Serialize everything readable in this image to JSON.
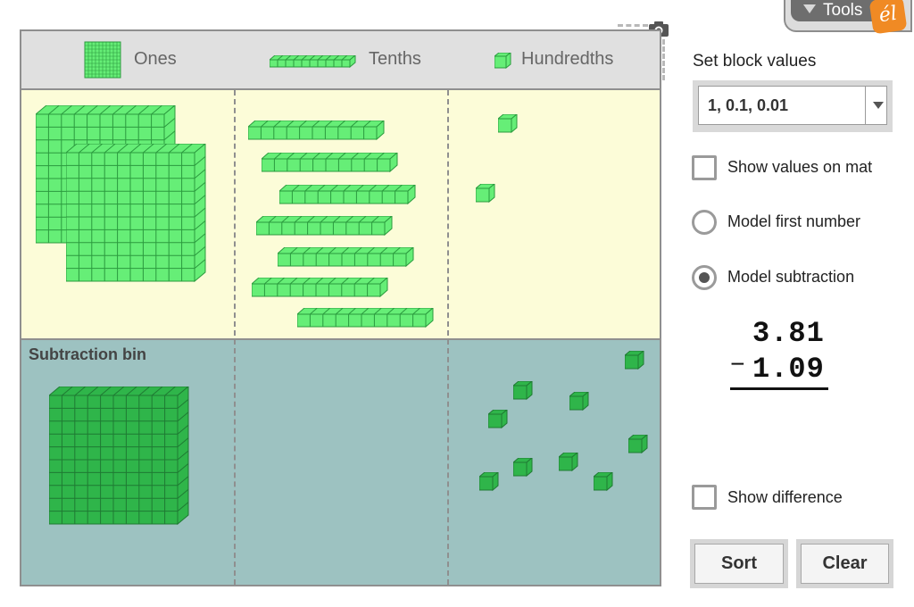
{
  "tools": {
    "label": "Tools",
    "logo_text": "él"
  },
  "mat": {
    "headers": {
      "ones": "Ones",
      "tenths": "Tenths",
      "hundredths": "Hundredths"
    },
    "subtraction_bin_label": "Subtraction bin"
  },
  "panel": {
    "set_block_values_label": "Set block values",
    "block_values_selected": "1, 0.1, 0.01",
    "show_values_on_mat": {
      "label": "Show values on mat",
      "checked": false
    },
    "model_first_number": {
      "label": "Model first number",
      "selected": false
    },
    "model_subtraction": {
      "label": "Model subtraction",
      "selected": true
    },
    "problem": {
      "top": "3.81",
      "operator": "−",
      "bottom": "1.09"
    },
    "show_difference": {
      "label": "Show difference",
      "checked": false
    },
    "sort_button": "Sort",
    "clear_button": "Clear"
  },
  "colors": {
    "block_light": "#66ee77",
    "block_dark": "#2fb54a",
    "mat_upper": "#fcfcd8",
    "mat_bin": "#9dc2c1"
  },
  "blocks_on_mat": {
    "ones": 2,
    "tenths": 7,
    "hundredths": 2
  },
  "blocks_in_bin": {
    "ones": 1,
    "tenths": 0,
    "hundredths": 9
  }
}
